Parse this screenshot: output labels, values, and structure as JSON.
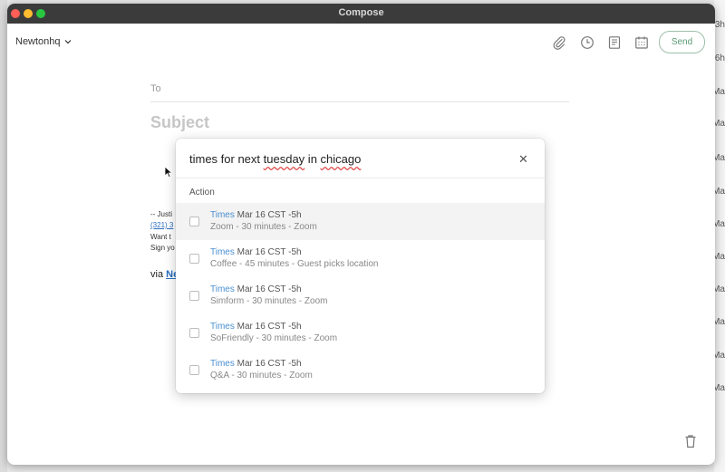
{
  "window": {
    "title": "Compose"
  },
  "header": {
    "account": "Newtonhq",
    "send_label": "Send"
  },
  "compose": {
    "to_label": "To",
    "subject_placeholder": "Subject",
    "signature": {
      "line1": "-- Justi",
      "line2": "(321) 3",
      "line3": "Want t",
      "line4": "Sign yo"
    },
    "via_prefix": "via",
    "via_link": "Ne"
  },
  "popup": {
    "query_parts": [
      "times for next ",
      "tuesday",
      " in ",
      "chicago"
    ],
    "section_label": "Action",
    "items": [
      {
        "keyword": "Times",
        "rest": " Mar 16 CST -5h",
        "detail": "Zoom - 30 minutes - Zoom"
      },
      {
        "keyword": "Times",
        "rest": " Mar 16 CST -5h",
        "detail": "Coffee - 45 minutes - Guest picks location"
      },
      {
        "keyword": "Times",
        "rest": " Mar 16 CST -5h",
        "detail": "Simform - 30 minutes - Zoom"
      },
      {
        "keyword": "Times",
        "rest": " Mar 16 CST -5h",
        "detail": "SoFriendly - 30 minutes - Zoom"
      },
      {
        "keyword": "Times",
        "rest": " Mar 16 CST -5h",
        "detail": "Q&A - 30 minutes - Zoom"
      }
    ]
  },
  "background": {
    "right_edge_text": [
      "3h",
      "6h",
      "Ma",
      "Ma",
      "Ma",
      "Ma",
      "Ma",
      "Ma",
      "Ma",
      "Ma",
      "Ma",
      "Ma"
    ]
  },
  "icons": [
    "attachment-icon",
    "clock-icon",
    "template-icon",
    "calendar-icon",
    "trash-icon",
    "close-icon",
    "chevron-down-icon",
    "cursor-icon"
  ],
  "colors": {
    "titlebar": "#3b3b3b",
    "link": "#2b6fc0",
    "keyword": "#4a8fd0",
    "send_border": "#9dbfa9"
  }
}
